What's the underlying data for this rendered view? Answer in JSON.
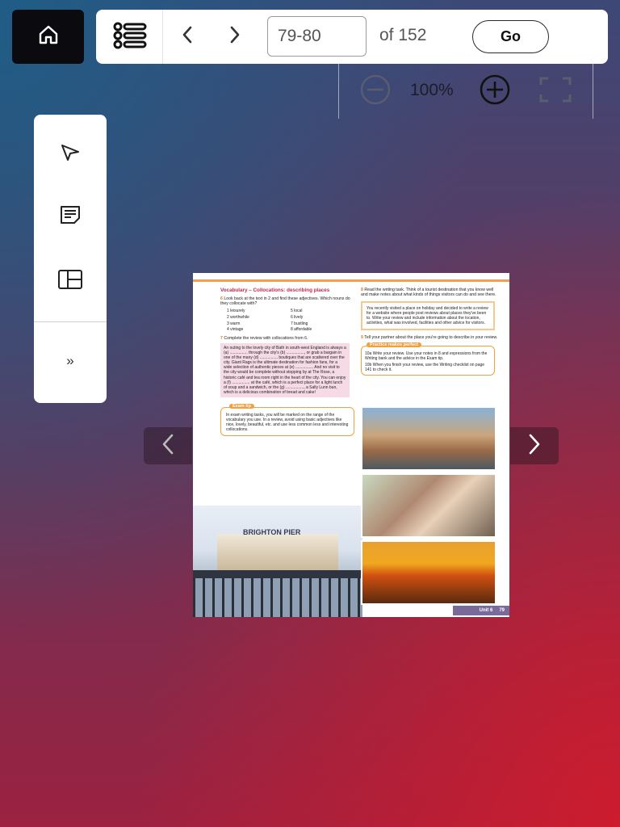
{
  "toolbar": {
    "page_value": "79-80",
    "page_total": "of 152",
    "go_label": "Go"
  },
  "zoom": {
    "level": "100%"
  },
  "sidebar": {
    "expand_label": "»"
  },
  "book_page": {
    "left": {
      "title": "Vocabulary – Collocations: describing places",
      "q6_num": "6",
      "q6": "Look back at the text in 2 and find these adjectives. Which nouns do they collocate with?",
      "words": [
        "1  leisurely",
        "5  local",
        "2  worthwhile",
        "6  lively",
        "3  warm",
        "7  bustling",
        "4  vintage",
        "8  affordable"
      ],
      "q7_num": "7",
      "q7": "Complete the review with collocations from 6.",
      "pink_text": "An outing to the lovely city of Bath in south-west England is always a (a) ................ through the city's (b) ................, or grab a bargain in one of the many (d) ................ boutiques that are scattered over the city. Giant Rags is the ultimate destination for fashion fans, for a wide selection of authentic pieces at (e) ................ And no visit to the city would be complete without stopping by at The Rose, a historic café and tea room right in the heart of the city. You can enjoy a (f) ................ at the café, which is a perfect place for a light lunch of soup and a sandwich, or the (g) ................, a Sally Lunn bun, which is a delicious combination of bread and cake!",
      "tip_label": "Exam tip",
      "tip_text": "In exam writing tasks, you will be marked on the range of the vocabulary you use. In a review, avoid using basic adjectives like nice, lovely, beautiful, etc. and use less common less and interesting collocations.",
      "pier_sign": "BRIGHTON PIER"
    },
    "right": {
      "q8_num": "8",
      "q8": "Read the writing task. Think of a tourist destination that you know well and make notes about what kinds of things visitors can do and see there.",
      "box_text": "You recently visited a place on holiday and decided to write a review for a website where people post reviews about places they've been to. Write your review and include information about the location, activities, what was involved, facilities and other advice for visitors.",
      "q9_num": "9",
      "q9": "Tell your partner about the place you're going to describe in your review.",
      "practice_label": "Practice makes perfect",
      "q10a": "10a Write your review. Use your notes in 8 and expressions from the Writing bank and the advice in the Exam tip.",
      "q10b": "10b When you finish your review, use the Writing checklist on page 141 to check it."
    },
    "unit_label": "Unit 6",
    "page_number": "79"
  }
}
